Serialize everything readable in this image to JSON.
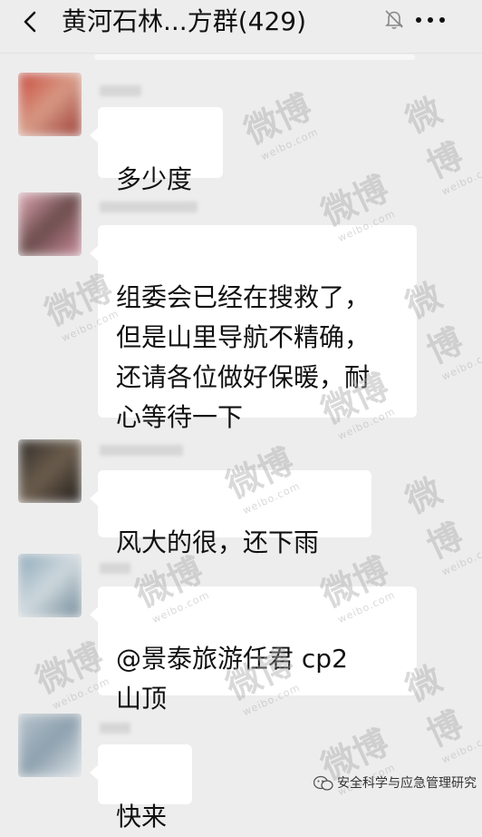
{
  "header": {
    "title": "黄河石林...方群(429)",
    "back_icon": "chevron-left-icon",
    "mute_icon": "bell-off-icon",
    "more_icon": "more-icon"
  },
  "messages": [
    {
      "text": "多少度",
      "avatar_colors": [
        "#c8483c",
        "#d79a85",
        "#9a3b34"
      ]
    },
    {
      "text": "组委会已经在搜救了，\n但是山里导航不精确，\n还请各位做好保暖，耐\n心等待一下",
      "avatar_colors": [
        "#e3aab7",
        "#6b4b4b",
        "#c98b9b"
      ]
    },
    {
      "text": "风大的很，还下雨",
      "avatar_colors": [
        "#2f2a25",
        "#6c5e4e",
        "#1c1815"
      ]
    },
    {
      "text": "@景泰旅游任君  cp2\n山顶",
      "avatar_colors": [
        "#8aa6b8",
        "#cfd9de",
        "#6e8796"
      ]
    },
    {
      "text": "快来",
      "avatar_colors": [
        "#b7c4ce",
        "#8da0ae",
        "#dde3e8"
      ]
    }
  ],
  "watermark": {
    "brand": "微博",
    "domain": "weibo.com"
  },
  "credit": {
    "text": "安全科学与应急管理研究"
  },
  "colors": {
    "background": "#ededed",
    "bubble": "#ffffff",
    "text": "#111111"
  }
}
